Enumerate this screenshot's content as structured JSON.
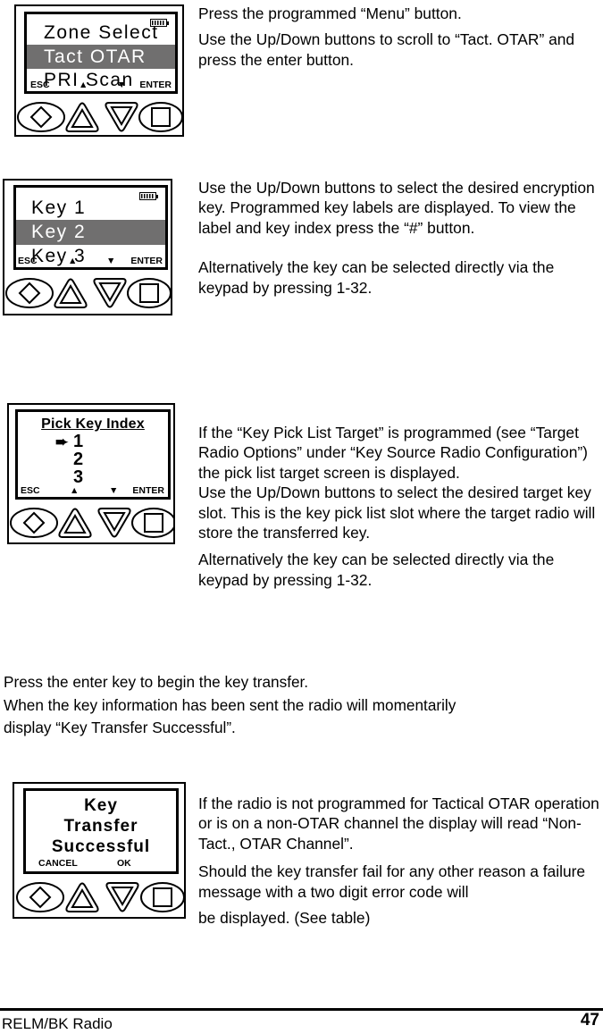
{
  "document": {
    "footer_left": "RELM/BK Radio",
    "footer_page": "47"
  },
  "steps": [
    {
      "id": "tact-otar-menu",
      "device": {
        "battery_icon": "battery-icon",
        "lines": [
          {
            "text": "Zone Select",
            "selected": false
          },
          {
            "text": "Tact OTAR",
            "selected": true
          },
          {
            "text": "PRI Scan",
            "selected": false
          }
        ],
        "softkeys": {
          "esc": "ESC",
          "up": "▲",
          "down": "▼",
          "enter": "ENTER"
        },
        "keypad": [
          "menu-diamond-button",
          "up-arrow-button",
          "down-arrow-button",
          "enter-square-button"
        ]
      },
      "text": [
        "Press the programmed “Menu” button.",
        "Use the Up/Down buttons to scroll to “Tact. OTAR” and press the enter button."
      ]
    },
    {
      "id": "key-select",
      "device": {
        "battery_icon": "battery-icon",
        "lines": [
          {
            "text": "Key 1",
            "selected": false
          },
          {
            "text": "Key 2",
            "selected": true
          },
          {
            "text": "Key 3",
            "selected": false
          }
        ],
        "softkeys": {
          "esc": "ESC",
          "up": "▲",
          "down": "▼",
          "enter": "ENTER"
        },
        "keypad": [
          "menu-diamond-button",
          "up-arrow-button",
          "down-arrow-button",
          "enter-square-button"
        ]
      },
      "text": [
        "Use the Up/Down buttons to select the desired encryption key. Programmed key labels are displayed. To view the label and key index press the “#” button.",
        "Alternatively the key can be selected directly via the keypad by pressing 1-32."
      ]
    },
    {
      "id": "pick-key-index",
      "device": {
        "title": "Pick Key Index",
        "cursor_icon": "right-arrow-cursor",
        "items": [
          "1",
          "2",
          "3"
        ],
        "softkeys": {
          "esc": "ESC",
          "up": "▲",
          "down": "▼",
          "enter": "ENTER"
        },
        "keypad": [
          "menu-diamond-button",
          "up-arrow-button",
          "down-arrow-button",
          "enter-square-button"
        ]
      },
      "text": [
        "If the “Key Pick List Target” is programmed (see “Target Radio Options” under “Key Source Radio Configuration”) the pick list target screen is displayed.",
        "Use the Up/Down buttons to select the desired target key slot. This is the key pick list slot where the target radio will store the transferred key.",
        "Alternatively the key can be selected directly via the keypad by pressing 1-32."
      ]
    },
    {
      "id": "key-transfer-successful",
      "device": {
        "lines": [
          "Key",
          "Transfer",
          "Successful"
        ],
        "softkeys": {
          "cancel": "CANCEL",
          "ok": "OK"
        },
        "keypad": [
          "menu-diamond-button",
          "up-arrow-button",
          "down-arrow-button",
          "enter-square-button"
        ]
      },
      "text": [
        "If the radio is not programmed for Tactical OTAR operation or is on a non-OTAR channel the display will read “Non-Tact., OTAR Channel”.",
        "Should the key transfer fail for any other reason a failure message with a two digit error code will",
        "be displayed. (See table)"
      ]
    }
  ],
  "transfer_note": [
    "Press the enter key to begin the key transfer.",
    "When the key information has been sent the radio will momentarily",
    "display “Key Transfer Successful”."
  ]
}
